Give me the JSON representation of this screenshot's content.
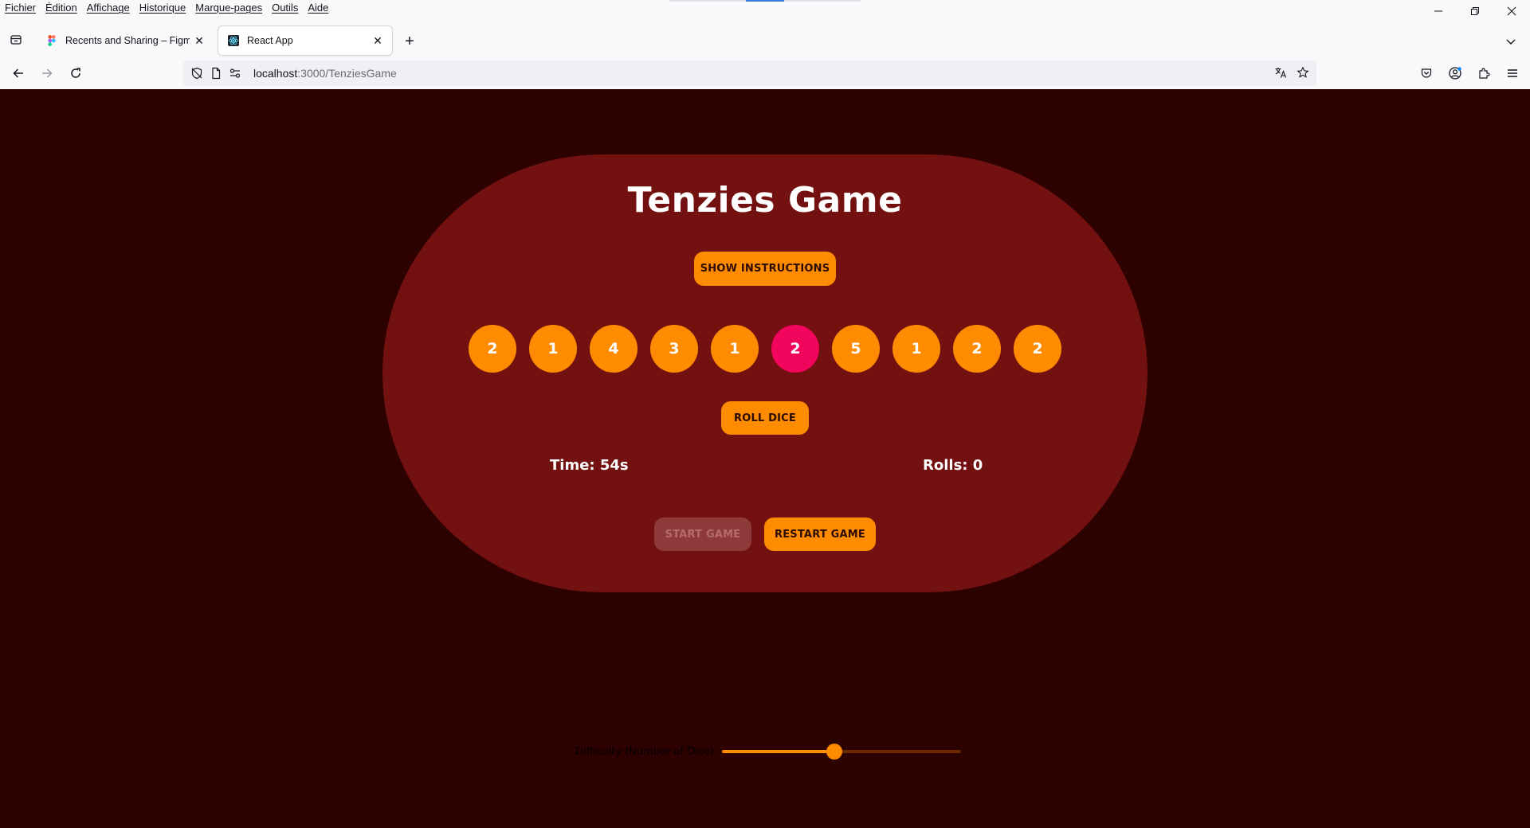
{
  "browser": {
    "menu": [
      "Fichier",
      "Édition",
      "Affichage",
      "Historique",
      "Marque-pages",
      "Outils",
      "Aide"
    ],
    "tabs": [
      {
        "label": "Recents and Sharing – Figma",
        "active": false,
        "favicon": "figma-icon"
      },
      {
        "label": "React App",
        "active": true,
        "favicon": "react-icon"
      }
    ],
    "url": {
      "host": "localhost",
      "path": ":3000/TenziesGame"
    }
  },
  "game": {
    "title": "Tenzies Game",
    "show_instructions_label": "SHOW INSTRUCTIONS",
    "roll_label": "ROLL DICE",
    "start_label": "START GAME",
    "restart_label": "RESTART GAME",
    "time_text": "Time: 54s",
    "rolls_text": "Rolls: 0",
    "dice": [
      {
        "value": "2",
        "held": false
      },
      {
        "value": "1",
        "held": false
      },
      {
        "value": "4",
        "held": false
      },
      {
        "value": "3",
        "held": false
      },
      {
        "value": "1",
        "held": false
      },
      {
        "value": "2",
        "held": true
      },
      {
        "value": "5",
        "held": false
      },
      {
        "value": "1",
        "held": false
      },
      {
        "value": "2",
        "held": false
      },
      {
        "value": "2",
        "held": false
      }
    ],
    "difficulty": {
      "label": "Difficulty (Number of Dice):",
      "level_fraction": 0.47
    }
  },
  "colors": {
    "page_bg": "#2e0101",
    "card_bg": "#731010",
    "accent": "#ff8c00",
    "held_die": "#f2055c",
    "disabled_button": "#8f3a3a"
  }
}
